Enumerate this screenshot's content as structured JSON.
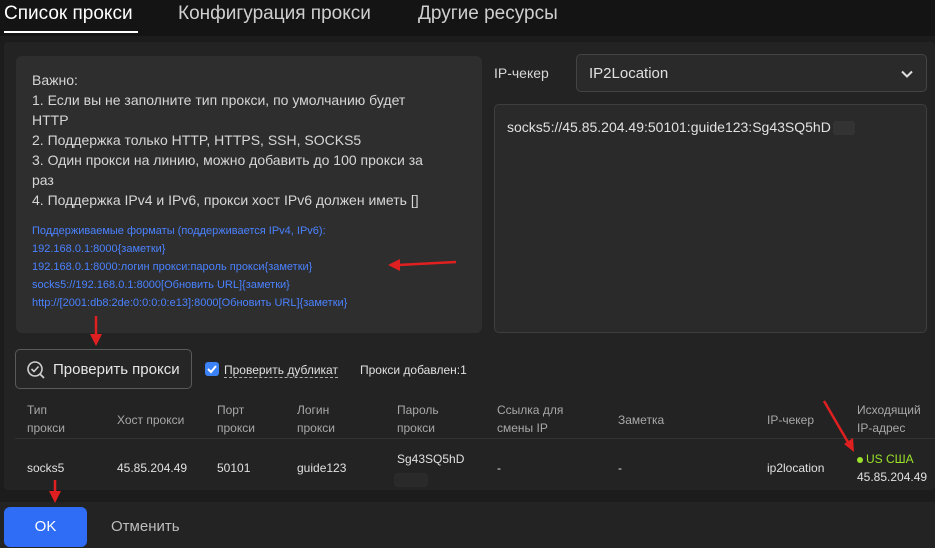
{
  "tabs": [
    {
      "label": "Список прокси"
    },
    {
      "label": "Конфигурация прокси"
    },
    {
      "label": "Другие ресурсы"
    }
  ],
  "notes": {
    "lines": [
      "Важно:",
      "1. Если вы не заполните тип прокси, по умолчанию будет",
      "HTTP",
      "2. Поддержка только HTTP, HTTPS, SSH, SOCKS5",
      "3. Один прокси на линию, можно добавить до 100 прокси за",
      "раз",
      "4. Поддержка IPv4 и IPv6, прокси хост IPv6 должен иметь []"
    ],
    "formats": [
      "Поддерживаемые форматы (поддерживается IPv4, IPv6):",
      "192.168.0.1:8000{заметки}",
      "192.168.0.1:8000:логин прокси:пароль прокси{заметки}",
      "socks5://192.168.0.1:8000[Обновить URL]{заметки}",
      "http://[2001:db8:2de:0:0:0:0:e13]:8000[Обновить URL]{заметки}"
    ]
  },
  "ip_checker": {
    "label": "IP-чекер",
    "value": "IP2Location"
  },
  "proxy_input": {
    "value": "socks5://45.85.204.49:50101:guide123:Sg43SQ5hD"
  },
  "check_button": {
    "label": "Проверить прокси"
  },
  "duplicate_check": {
    "label": "Проверить дубликат",
    "checked": true
  },
  "added_status": "Прокси добавлен:1",
  "table": {
    "headers": [
      [
        "Тип",
        "прокси"
      ],
      [
        "Хост прокси"
      ],
      [
        "Порт",
        "прокси"
      ],
      [
        "Логин",
        "прокси"
      ],
      [
        "Пароль",
        "прокси"
      ],
      [
        "Ссылка для",
        "смены IP"
      ],
      [
        "Заметка"
      ],
      [
        "IP-чекер"
      ],
      [
        "Исходящий",
        "IP-адрес"
      ]
    ],
    "row": {
      "type": "socks5",
      "host": "45.85.204.49",
      "port": "50101",
      "login": "guide123",
      "password": "Sg43SQ5hD",
      "change_url": "-",
      "note": "-",
      "checker": "ip2location",
      "location": "US США",
      "outgoing_ip": "45.85.204.49"
    }
  },
  "footer": {
    "ok_label": "OK",
    "cancel_label": "Отменить"
  },
  "colors": {
    "accent": "#2f6df6",
    "link": "#4a82ff",
    "status_ok": "#9be22a",
    "annotation_arrow": "#e02020"
  }
}
